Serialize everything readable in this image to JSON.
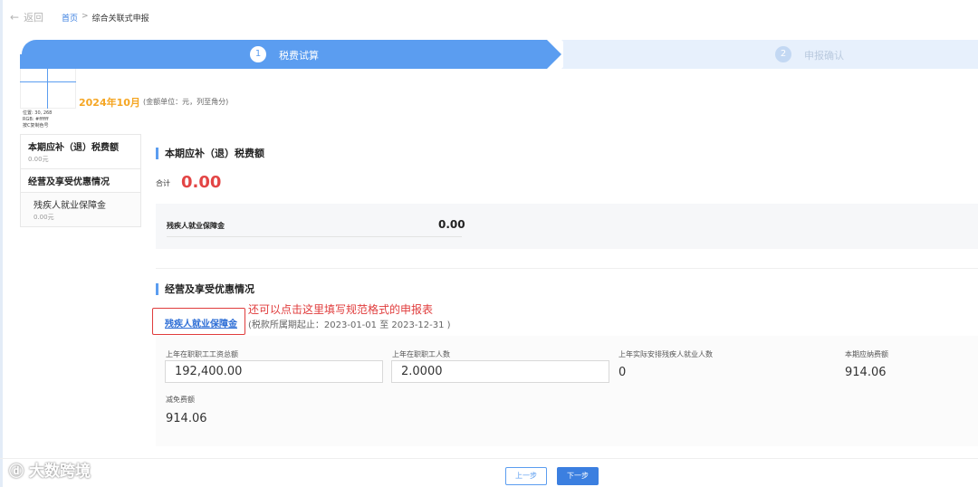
{
  "nav_top": {
    "back_label": "返回",
    "crumb_home": "首页",
    "crumb_sep": ">",
    "crumb_current": "综合关联式申报"
  },
  "steps": [
    {
      "num": "1",
      "label": "税费试算"
    },
    {
      "num": "2",
      "label": "申报确认"
    }
  ],
  "picker": {
    "position": "位置: 30, 268",
    "rgb": "RGB: #ffffff",
    "hint": "按C复制色号"
  },
  "period": {
    "label": "2024年10月",
    "unit_note": "(金额单位：元，列至角分)"
  },
  "sidebar": {
    "items": [
      {
        "title": "本期应补（退）税费额",
        "sub": "0.00元"
      },
      {
        "title": "经营及享受优惠情况",
        "sub": ""
      },
      {
        "title": "残疾人就业保障金",
        "sub": "0.00元"
      }
    ]
  },
  "section1": {
    "heading": "本期应补（退）税费额",
    "total_label": "合计",
    "total_value": "0.00",
    "item_label": "残疾人就业保障金",
    "item_value": "0.00"
  },
  "section2": {
    "heading": "经营及享受优惠情况",
    "link_label": "残疾人就业保障金",
    "period_text": "(税款所属期起止：2023-01-01 至 2023-12-31 )",
    "annotation": "还可以点击这里填写规范格式的申报表",
    "fields": {
      "wage_label": "上年在职职工工资总额",
      "wage_value": "192,400.00",
      "staff_label": "上年在职职工人数",
      "staff_value": "2.0000",
      "disabled_label": "上年实际安排残疾人就业人数",
      "disabled_value": "0",
      "payable_label": "本期应纳费额",
      "payable_value": "914.06",
      "reduction_label": "减免费额",
      "reduction_value": "914.06"
    }
  },
  "footer": {
    "prev_label": "上一步",
    "next_label": "下一步",
    "watermark": "大数跨境"
  }
}
